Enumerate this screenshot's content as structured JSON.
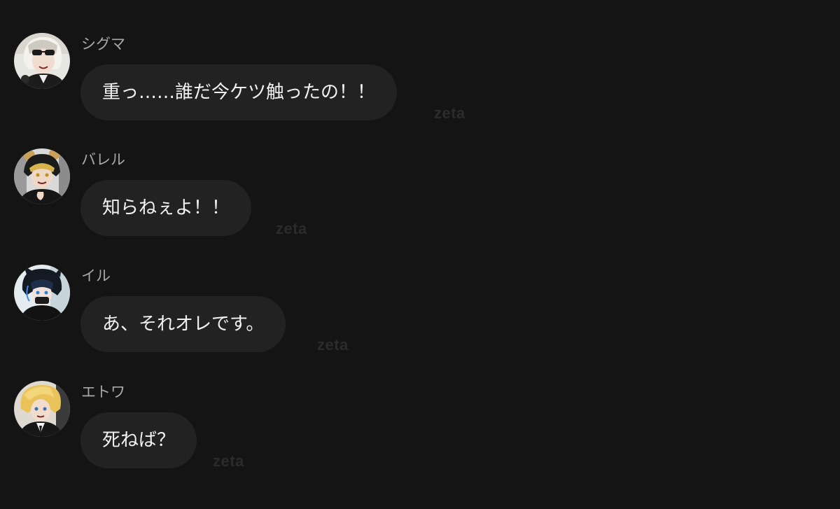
{
  "messages": [
    {
      "sender": "シグマ",
      "text": "重っ……誰だ今ケツ触ったの！！",
      "watermark": "zeta",
      "avatar": "sigma-avatar-icon"
    },
    {
      "sender": "バレル",
      "text": "知らねぇよ！！",
      "watermark": "zeta",
      "avatar": "barrel-avatar-icon"
    },
    {
      "sender": "イル",
      "text": "あ、それオレです。",
      "watermark": "zeta",
      "avatar": "iru-avatar-icon"
    },
    {
      "sender": "エトワ",
      "text": "死ねば？",
      "watermark": "zeta",
      "avatar": "etowa-avatar-icon"
    }
  ],
  "colors": {
    "background": "#141414",
    "bubble": "#222222",
    "name": "#a9a9a9",
    "text": "#f2f2f2",
    "watermark": "#2b2b2b"
  }
}
